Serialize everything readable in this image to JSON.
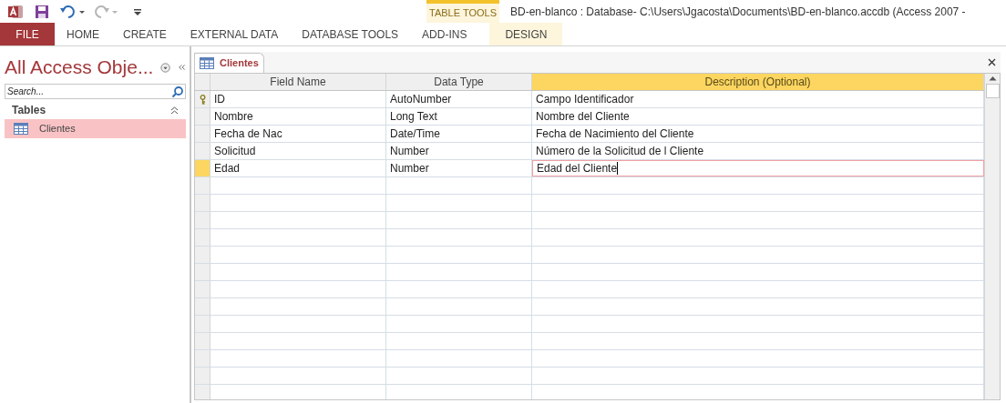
{
  "window": {
    "title": "BD-en-blanco : Database- C:\\Users\\Jgacosta\\Documents\\BD-en-blanco.accdb (Access 2007 -"
  },
  "quick_access": [
    {
      "kind": "save",
      "disabled": false
    },
    {
      "kind": "undo",
      "disabled": false
    },
    {
      "kind": "redo",
      "disabled": true
    },
    {
      "kind": "customize",
      "disabled": false
    }
  ],
  "ribbon_tabs": [
    {
      "label": "FILE",
      "kind": "file"
    },
    {
      "label": "HOME",
      "kind": "tab"
    },
    {
      "label": "CREATE",
      "kind": "tab"
    },
    {
      "label": "EXTERNAL DATA",
      "kind": "tab"
    },
    {
      "label": "DATABASE TOOLS",
      "kind": "tab"
    },
    {
      "label": "ADD-INS",
      "kind": "tab"
    }
  ],
  "contextual_group": {
    "title": "TABLE TOOLS",
    "tabs": [
      "DESIGN"
    ]
  },
  "navigation_pane": {
    "title": "All Access Obje...",
    "search": {
      "placeholder": "Search..."
    },
    "groups": [
      {
        "label": "Tables",
        "expanded": true,
        "items": [
          {
            "label": "Clientes",
            "selected": true
          }
        ]
      }
    ]
  },
  "document_tab": {
    "label": "Clientes"
  },
  "table": {
    "columns": [
      {
        "label": "Field Name",
        "selected": false
      },
      {
        "label": "Data Type",
        "selected": false
      },
      {
        "label": "Description (Optional)",
        "selected": true
      }
    ],
    "rows": [
      {
        "cells": [
          "ID",
          "AutoNumber",
          "Campo Identificador"
        ],
        "primary_key": true,
        "selected": false
      },
      {
        "cells": [
          "Nombre",
          "Long Text",
          "Nombre del Cliente"
        ],
        "primary_key": false,
        "selected": false
      },
      {
        "cells": [
          "Fecha de Nac",
          "Date/Time",
          "Fecha de Nacimiento del Cliente"
        ],
        "primary_key": false,
        "selected": false
      },
      {
        "cells": [
          "Solicitud",
          "Number",
          "Número de la Solicitud de l Cliente"
        ],
        "primary_key": false,
        "selected": false
      },
      {
        "cells": [
          "Edad",
          "Number",
          "Edad del Cliente"
        ],
        "primary_key": false,
        "selected": true
      }
    ]
  }
}
